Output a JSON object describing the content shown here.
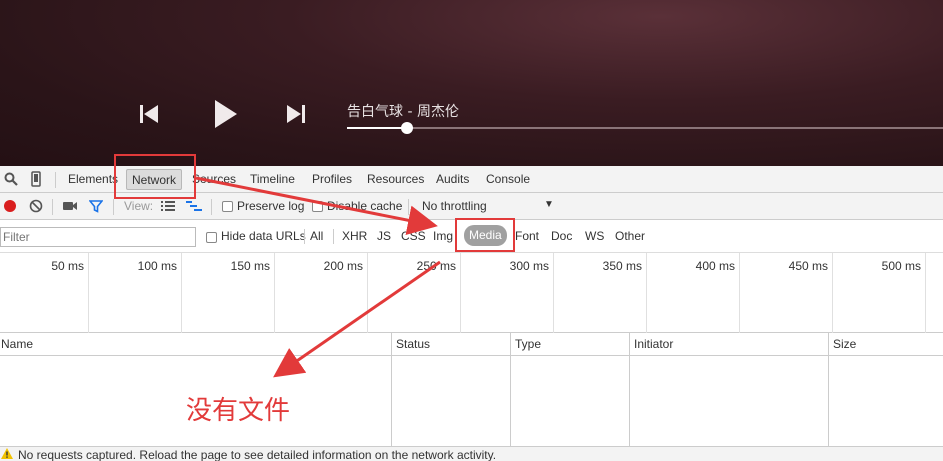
{
  "player": {
    "song_title": "告白气球 - 周杰伦",
    "progress": 0.1
  },
  "devtools": {
    "tabs": [
      "Elements",
      "Network",
      "Sources",
      "Timeline",
      "Profiles",
      "Resources",
      "Audits",
      "Console"
    ],
    "active_tab": "Network",
    "toolbar": {
      "view_label": "View:",
      "preserve_log": "Preserve log",
      "disable_cache": "Disable cache",
      "throttling": "No throttling"
    },
    "filter": {
      "placeholder": "Filter",
      "hide_data_urls": "Hide data URLs",
      "types": [
        "All",
        "XHR",
        "JS",
        "CSS",
        "Img",
        "Media",
        "Font",
        "Doc",
        "WS",
        "Other"
      ],
      "active_type": "Media"
    },
    "timeline_ticks": [
      "50 ms",
      "100 ms",
      "150 ms",
      "200 ms",
      "250 ms",
      "300 ms",
      "350 ms",
      "400 ms",
      "450 ms",
      "500 ms"
    ],
    "columns": [
      "Name",
      "Status",
      "Type",
      "Initiator",
      "Size"
    ],
    "status_message": "No requests captured. Reload the page to see detailed information on the network activity."
  },
  "annotation": {
    "text": "没有文件",
    "color": "#e23a3a"
  }
}
